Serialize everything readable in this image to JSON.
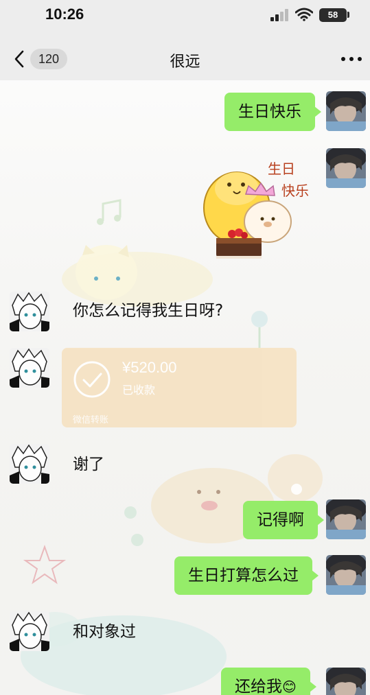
{
  "status_bar": {
    "time": "10:26",
    "battery": "58",
    "icons": [
      "signal-icon",
      "wifi-icon",
      "battery-icon"
    ]
  },
  "nav": {
    "unread_count": "120",
    "title": "很远",
    "icons": [
      "back-chevron-icon",
      "more-dots-icon"
    ]
  },
  "messages": [
    {
      "side": "out",
      "type": "text",
      "text": "生日快乐"
    },
    {
      "side": "out",
      "type": "sticker",
      "sticker_text": [
        "生日",
        "快乐"
      ]
    },
    {
      "side": "in",
      "type": "text",
      "text": "你怎么记得我生日呀?"
    },
    {
      "side": "in",
      "type": "transfer",
      "amount": "¥520.00",
      "status": "已收款",
      "footer": "微信转账"
    },
    {
      "side": "in",
      "type": "text",
      "text": "谢了"
    },
    {
      "side": "out",
      "type": "text",
      "text": "记得啊"
    },
    {
      "side": "out",
      "type": "text",
      "text": "生日打算怎么过"
    },
    {
      "side": "in",
      "type": "text",
      "text": "和对象过"
    },
    {
      "side": "out",
      "type": "text",
      "text": "还给我",
      "emoji": "😊"
    }
  ],
  "colors": {
    "outgoing_bubble": "#95ec69",
    "background": "#ededed",
    "transfer_card": "#f6e3c4"
  }
}
